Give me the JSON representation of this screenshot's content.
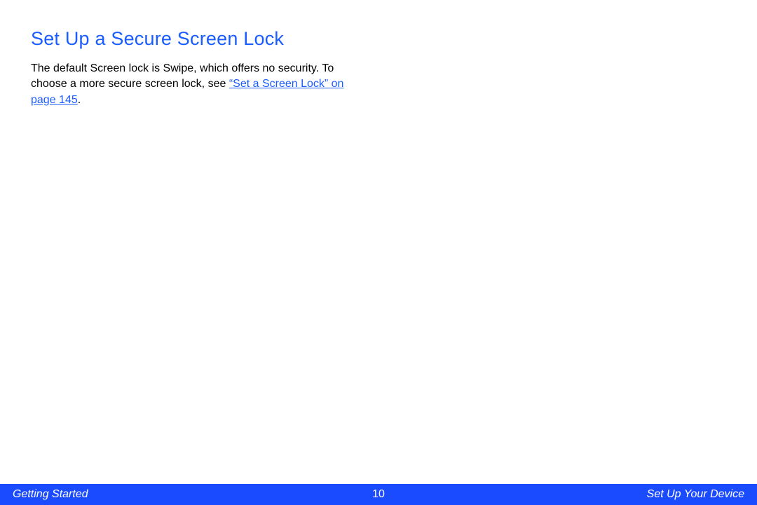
{
  "heading": "Set Up a Secure Screen Lock",
  "body_pre_link": "The default Screen lock is Swipe, which offers no security. To choose a more secure screen lock, see ",
  "link_text": "“Set a Screen Lock” on page 145",
  "body_post_link": ".",
  "footer": {
    "left": "Getting Started",
    "page": "10",
    "right": "Set Up Your Device"
  }
}
